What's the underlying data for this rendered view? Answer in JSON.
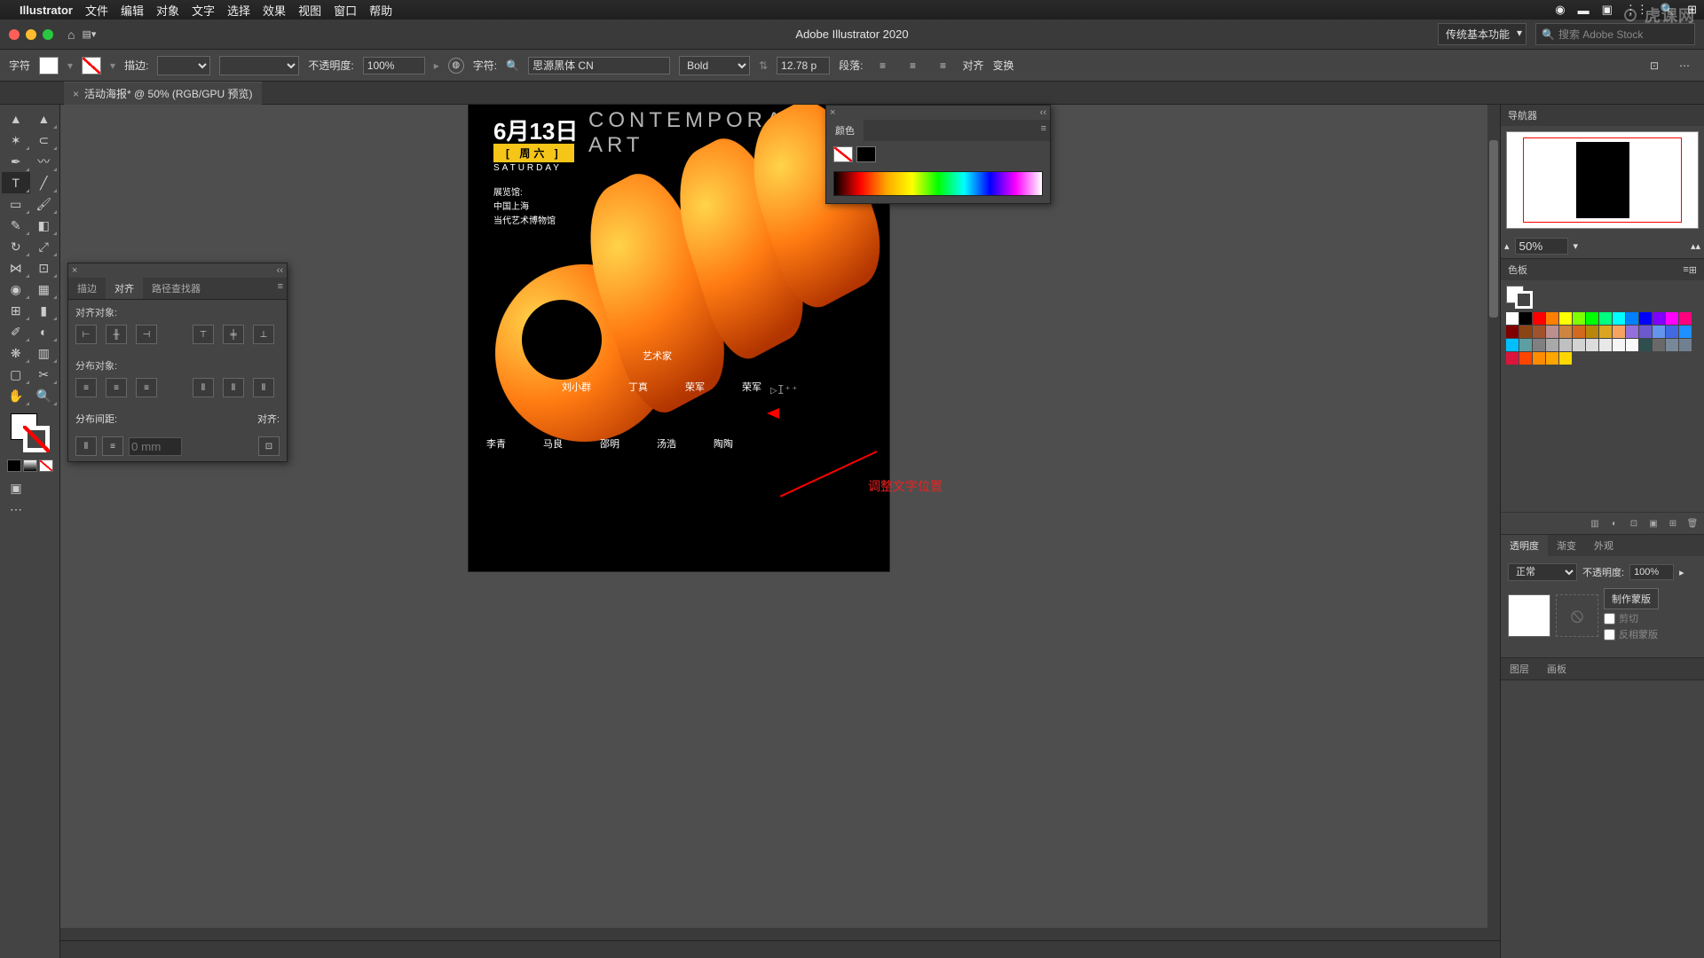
{
  "menubar": {
    "app": "Illustrator",
    "items": [
      "文件",
      "编辑",
      "对象",
      "文字",
      "选择",
      "效果",
      "视图",
      "窗口",
      "帮助"
    ]
  },
  "titlebar": {
    "title": "Adobe Illustrator 2020",
    "workspace": "传统基本功能",
    "search_placeholder": "搜索 Adobe Stock"
  },
  "watermark": "⊙ 虎课网",
  "optbar": {
    "char_label": "字符",
    "stroke_label": "描边:",
    "opacity_label": "不透明度:",
    "opacity_value": "100%",
    "font_label": "字符:",
    "font_family": "思源黑体 CN",
    "font_weight": "Bold",
    "font_size": "12.78 p",
    "para_label": "段落:",
    "align_label": "对齐",
    "transform_label": "变换"
  },
  "doctab": {
    "name": "活动海报* @ 50% (RGB/GPU 预览)"
  },
  "poster": {
    "date": "6月13日",
    "day": "[ 周六 ]",
    "sat": "SATURDAY",
    "title_line1": "CONTEMPORAR",
    "title_line2": "ART",
    "info1": "展览馆:",
    "info2": "中国上海",
    "info3": "当代艺术博物馆",
    "artists_label": "艺术家",
    "row1": [
      "刘小群",
      "丁真",
      "荣军",
      "荣军"
    ],
    "row2": [
      "李青",
      "马良",
      "邵明",
      "汤浩",
      "陶陶"
    ]
  },
  "annotation": "调整文字位置",
  "panels": {
    "align": {
      "tabs": [
        "描边",
        "对齐",
        "路径查找器"
      ],
      "active_tab": 1,
      "align_objects": "对齐对象:",
      "distribute_objects": "分布对象:",
      "distribute_spacing": "分布间距:",
      "align_to": "对齐:",
      "spacing_value": "0 mm"
    },
    "color": {
      "tabs": [
        "颜色"
      ]
    },
    "navigator": {
      "title": "导航器",
      "zoom": "50%"
    },
    "swatches": {
      "title": "色板"
    },
    "transparency": {
      "tabs": [
        "透明度",
        "渐变",
        "外观"
      ],
      "active_tab": 0,
      "blend": "正常",
      "opacity_label": "不透明度:",
      "opacity": "100%",
      "make_mask": "制作蒙版",
      "clip": "剪切",
      "invert": "反相蒙版"
    },
    "layers": {
      "tabs": [
        "图层",
        "画板"
      ]
    }
  },
  "swatch_colors": [
    "#ffffff",
    "#000000",
    "#ff0000",
    "#ff7f00",
    "#ffff00",
    "#7fff00",
    "#00ff00",
    "#00ff7f",
    "#00ffff",
    "#007fff",
    "#0000ff",
    "#7f00ff",
    "#ff00ff",
    "#ff007f",
    "#800000",
    "#8b4513",
    "#a0522d",
    "#bc8f8f",
    "#cd853f",
    "#d2691e",
    "#b8860b",
    "#daa520",
    "#f4a460",
    "#9370db",
    "#6a5acd",
    "#6495ed",
    "#4169e1",
    "#1e90ff",
    "#00bfff",
    "#5f9ea0",
    "#808080",
    "#a9a9a9",
    "#c0c0c0",
    "#d3d3d3",
    "#dcdcdc",
    "#e8e8e8",
    "#f5f5f5",
    "#fafafa",
    "#2f4f4f",
    "#696969",
    "#778899",
    "#708090",
    "#dc143c",
    "#ff4500",
    "#ff8c00",
    "#ffa500",
    "#ffd700"
  ]
}
